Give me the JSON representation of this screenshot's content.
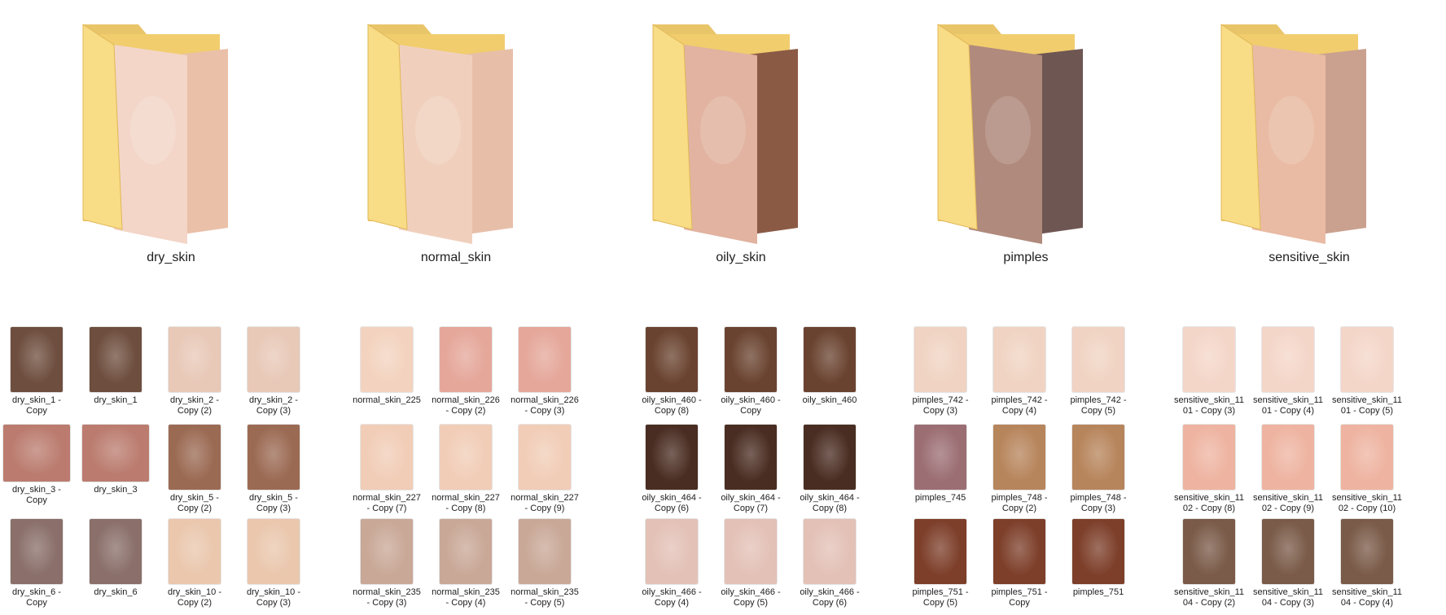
{
  "folders": [
    {
      "name": "dry_skin",
      "colors": [
        "#f3d6c8",
        "#eac0a9"
      ]
    },
    {
      "name": "normal_skin",
      "colors": [
        "#f0d0bd",
        "#e7bfa8"
      ]
    },
    {
      "name": "oily_skin",
      "colors": [
        "#e1b3a0",
        "#8b5a45"
      ]
    },
    {
      "name": "pimples",
      "colors": [
        "#b08a7c",
        "#6e5653"
      ]
    },
    {
      "name": "sensitive_skin",
      "colors": [
        "#e9bba4",
        "#caa08f"
      ]
    }
  ],
  "groups": [
    {
      "name": "dry_skin",
      "rows": [
        [
          {
            "label": "dry_skin_1 -\nCopy",
            "color": "#6e4e3e"
          },
          {
            "label": "dry_skin_1",
            "color": "#6e4e3e"
          },
          {
            "label": "dry_skin_2 -\nCopy (2)",
            "color": "#e8c8b7"
          },
          {
            "label": "dry_skin_2 -\nCopy (3)",
            "color": "#e8c8b7"
          }
        ],
        [
          {
            "label": "dry_skin_3 -\nCopy",
            "color": "#bb7c6f",
            "wide": true
          },
          {
            "label": "dry_skin_3",
            "color": "#bb7c6f",
            "wide": true
          },
          {
            "label": "dry_skin_5 -\nCopy (2)",
            "color": "#9b6a53"
          },
          {
            "label": "dry_skin_5 -\nCopy (3)",
            "color": "#9b6a53"
          }
        ],
        [
          {
            "label": "dry_skin_6 -\nCopy",
            "color": "#8a6f6a"
          },
          {
            "label": "dry_skin_6",
            "color": "#8a6f6a"
          },
          {
            "label": "dry_skin_10 -\nCopy (2)",
            "color": "#eac7ad"
          },
          {
            "label": "dry_skin_10 -\nCopy (3)",
            "color": "#eac7ad"
          }
        ]
      ]
    },
    {
      "name": "normal_skin",
      "rows": [
        [
          {
            "label": "normal_skin_225",
            "color": "#f3d3bf"
          },
          {
            "label": "normal_skin_226\n- Copy (2)",
            "color": "#e5a79a"
          },
          {
            "label": "normal_skin_226\n- Copy (3)",
            "color": "#e5a79a"
          }
        ],
        [
          {
            "label": "normal_skin_227\n- Copy (7)",
            "color": "#f1cdb7"
          },
          {
            "label": "normal_skin_227\n- Copy (8)",
            "color": "#f1cdb7"
          },
          {
            "label": "normal_skin_227\n- Copy (9)",
            "color": "#f1cdb7"
          }
        ],
        [
          {
            "label": "normal_skin_235\n- Copy (3)",
            "color": "#c9a897"
          },
          {
            "label": "normal_skin_235\n- Copy (4)",
            "color": "#c9a897"
          },
          {
            "label": "normal_skin_235\n- Copy (5)",
            "color": "#c9a897"
          }
        ]
      ]
    },
    {
      "name": "oily_skin",
      "rows": [
        [
          {
            "label": "oily_skin_460 -\nCopy (8)",
            "color": "#6a4330"
          },
          {
            "label": "oily_skin_460 -\nCopy",
            "color": "#6a4330"
          },
          {
            "label": "oily_skin_460",
            "color": "#6a4330"
          }
        ],
        [
          {
            "label": "oily_skin_464 -\nCopy (6)",
            "color": "#4a2d22"
          },
          {
            "label": "oily_skin_464 -\nCopy (7)",
            "color": "#4a2d22"
          },
          {
            "label": "oily_skin_464 -\nCopy (8)",
            "color": "#4a2d22"
          }
        ],
        [
          {
            "label": "oily_skin_466 -\nCopy (4)",
            "color": "#e3c1b7"
          },
          {
            "label": "oily_skin_466 -\nCopy (5)",
            "color": "#e3c1b7"
          },
          {
            "label": "oily_skin_466 -\nCopy (6)",
            "color": "#e3c1b7"
          }
        ]
      ]
    },
    {
      "name": "pimples",
      "rows": [
        [
          {
            "label": "pimples_742 -\nCopy (3)",
            "color": "#f0d3c2"
          },
          {
            "label": "pimples_742 -\nCopy (4)",
            "color": "#f0d3c2"
          },
          {
            "label": "pimples_742 -\nCopy (5)",
            "color": "#f0d3c2"
          }
        ],
        [
          {
            "label": "pimples_745",
            "color": "#9b6e73"
          },
          {
            "label": "pimples_748 -\nCopy (2)",
            "color": "#b7855c"
          },
          {
            "label": "pimples_748 -\nCopy (3)",
            "color": "#b7855c"
          }
        ],
        [
          {
            "label": "pimples_751 -\nCopy (5)",
            "color": "#7d3f2a"
          },
          {
            "label": "pimples_751 -\nCopy",
            "color": "#7d3f2a"
          },
          {
            "label": "pimples_751",
            "color": "#7d3f2a"
          }
        ]
      ]
    },
    {
      "name": "sensitive_skin",
      "rows": [
        [
          {
            "label": "sensitive_skin_11\n01 - Copy (3)",
            "color": "#f4d6c9"
          },
          {
            "label": "sensitive_skin_11\n01 - Copy (4)",
            "color": "#f4d6c9"
          },
          {
            "label": "sensitive_skin_11\n01 - Copy (5)",
            "color": "#f4d6c9"
          }
        ],
        [
          {
            "label": "sensitive_skin_11\n02 - Copy (8)",
            "color": "#eeb4a1"
          },
          {
            "label": "sensitive_skin_11\n02 - Copy (9)",
            "color": "#eeb4a1"
          },
          {
            "label": "sensitive_skin_11\n02 - Copy (10)",
            "color": "#eeb4a1"
          }
        ],
        [
          {
            "label": "sensitive_skin_11\n04 - Copy (2)",
            "color": "#7a5a48"
          },
          {
            "label": "sensitive_skin_11\n04 - Copy (3)",
            "color": "#7a5a48"
          },
          {
            "label": "sensitive_skin_11\n04 - Copy (4)",
            "color": "#7a5a48"
          }
        ]
      ]
    }
  ]
}
